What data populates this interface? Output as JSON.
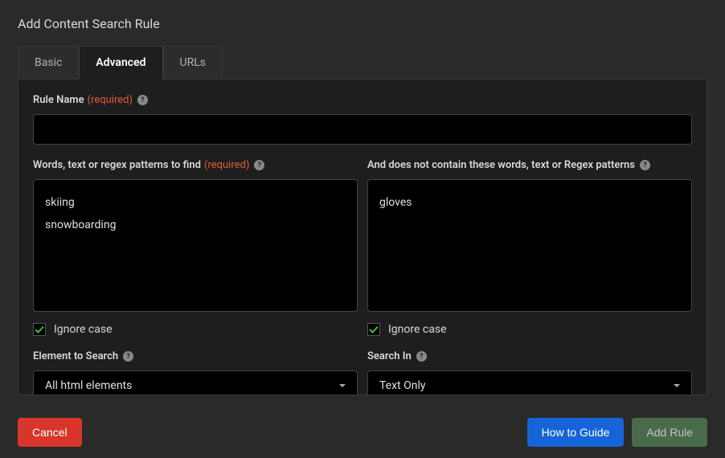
{
  "dialog": {
    "title": "Add Content Search Rule"
  },
  "tabs": {
    "basic": "Basic",
    "advanced": "Advanced",
    "urls": "URLs"
  },
  "form": {
    "ruleName": {
      "label": "Rule Name",
      "required": "(required)",
      "value": ""
    },
    "wordsToFind": {
      "label": "Words, text or regex patterns to find",
      "required": "(required)",
      "value": "skiing\nsnowboarding"
    },
    "excludeWords": {
      "label": "And does not contain these words, text or Regex patterns",
      "value": "gloves"
    },
    "ignoreCase": {
      "left": {
        "label": "Ignore case",
        "checked": true
      },
      "right": {
        "label": "Ignore case",
        "checked": true
      }
    },
    "elementToSearch": {
      "label": "Element to Search",
      "value": "All html elements"
    },
    "searchIn": {
      "label": "Search In",
      "value": "Text Only"
    }
  },
  "footer": {
    "cancel": "Cancel",
    "howToGuide": "How to Guide",
    "addRule": "Add Rule"
  }
}
